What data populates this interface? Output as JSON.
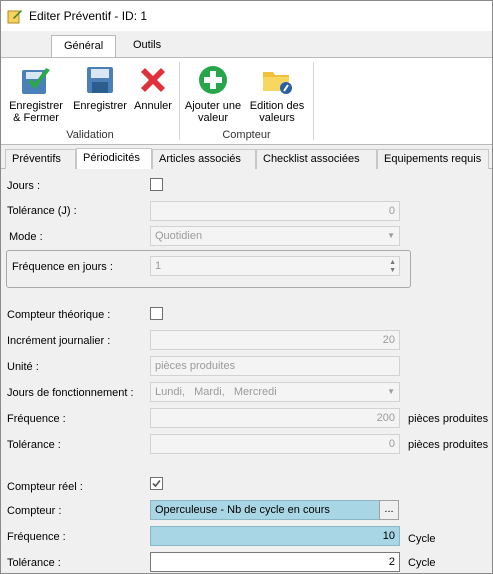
{
  "window": {
    "title": "Editer Préventif - ID: 1"
  },
  "ribbon": {
    "tabs": [
      {
        "label": "Général"
      },
      {
        "label": "Outils"
      }
    ],
    "groups": {
      "validation": {
        "label": "Validation",
        "save_close": "Enregistrer\n& Fermer",
        "save": "Enregistrer",
        "cancel": "Annuler"
      },
      "compteur": {
        "label": "Compteur",
        "add_value": "Ajouter une\nvaleur",
        "edit_values": "Edition des\nvaleurs"
      }
    }
  },
  "subtabs": [
    {
      "label": "Préventifs"
    },
    {
      "label": "Périodicités"
    },
    {
      "label": "Articles associés"
    },
    {
      "label": "Checklist associées"
    },
    {
      "label": "Equipements requis"
    }
  ],
  "form": {
    "jours": {
      "label": "Jours :",
      "checked": false
    },
    "tolerance_j": {
      "label": "Tolérance (J) :",
      "value": "0"
    },
    "mode": {
      "label": "Mode :",
      "value": "Quotidien"
    },
    "frequence_jours": {
      "label": "Fréquence en jours :",
      "value": "1"
    },
    "compteur_theorique": {
      "label": "Compteur théorique :",
      "checked": false
    },
    "increment": {
      "label": "Incrément journalier :",
      "value": "20"
    },
    "unite": {
      "label": "Unité :",
      "value": "pièces produites"
    },
    "jours_fonct": {
      "label": "Jours de fonctionnement :",
      "value": "Lundi,   Mardi,   Mercredi"
    },
    "frequence_theo": {
      "label": "Fréquence :",
      "value": "200",
      "unit": "pièces produites"
    },
    "tolerance_theo": {
      "label": "Tolérance :",
      "value": "0",
      "unit": "pièces produites"
    },
    "compteur_reel": {
      "label": "Compteur réel :",
      "checked": true
    },
    "compteur": {
      "label": "Compteur :",
      "value": "Operculeuse - Nb de cycle en cours",
      "button": "..."
    },
    "frequence_reel": {
      "label": "Fréquence :",
      "value": "10",
      "unit": "Cycle"
    },
    "tolerance_reel": {
      "label": "Tolérance :",
      "value": "2",
      "unit": "Cycle"
    }
  }
}
